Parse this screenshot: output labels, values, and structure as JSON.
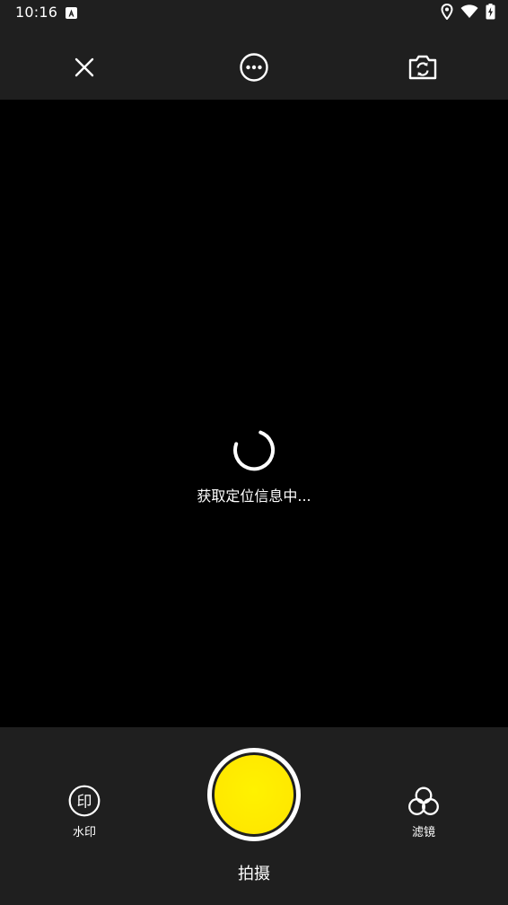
{
  "status_bar": {
    "time": "10:16",
    "icons": [
      "notification-a-icon",
      "location-icon",
      "wifi-icon",
      "battery-charging-icon"
    ]
  },
  "toolbar": {
    "close_icon": "close-icon",
    "more_icon": "more-options-icon",
    "switch_camera_icon": "switch-camera-icon"
  },
  "viewfinder": {
    "loading_text": "获取定位信息中..."
  },
  "bottom_bar": {
    "watermark_label": "水印",
    "watermark_icon_glyph": "印",
    "filter_label": "滤镜",
    "shoot_label": "拍摄",
    "shutter_color": "#ffe800"
  }
}
